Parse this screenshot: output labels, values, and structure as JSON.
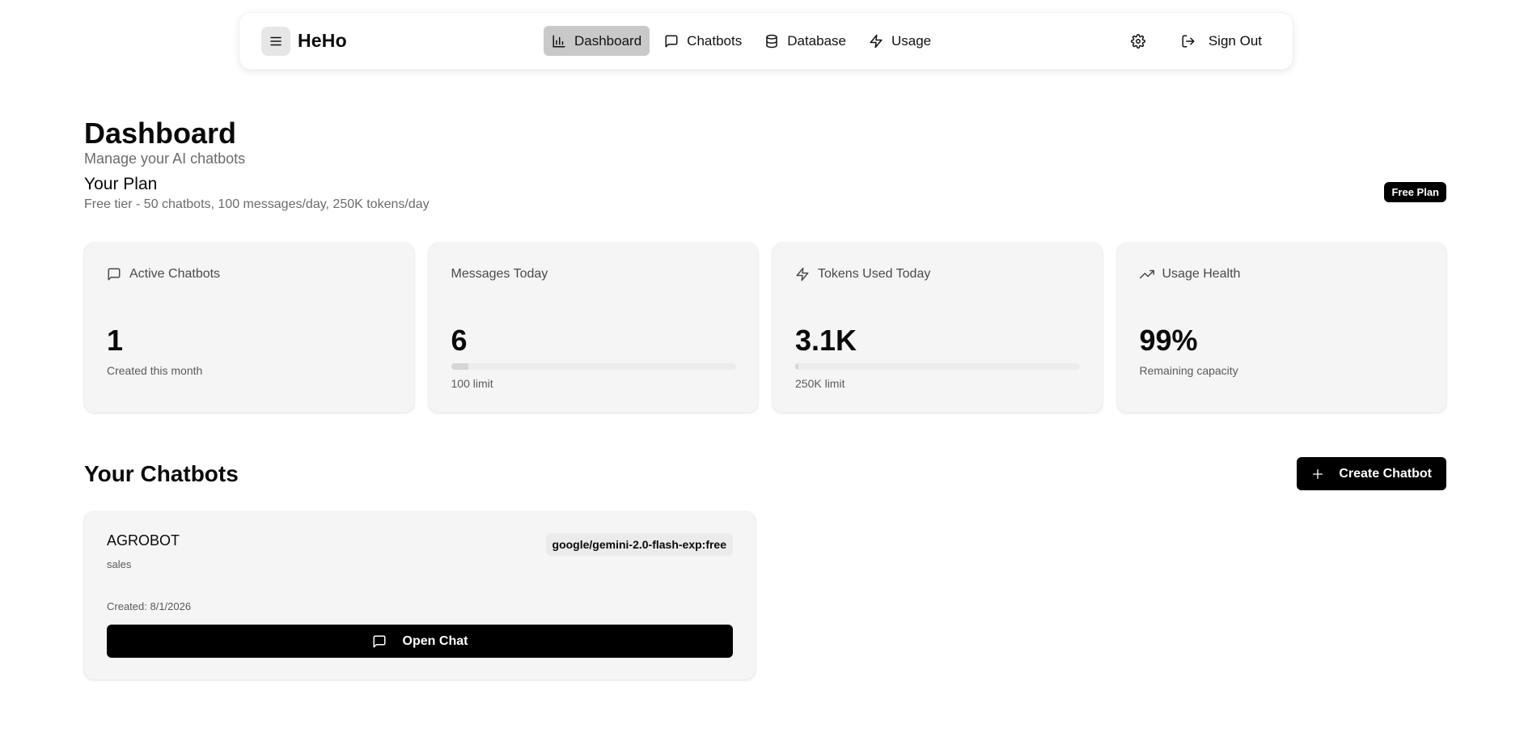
{
  "nav": {
    "brand": "HeHo",
    "items": [
      {
        "label": "Dashboard",
        "icon": "bar-chart-icon",
        "active": true
      },
      {
        "label": "Chatbots",
        "icon": "message-square-icon",
        "active": false
      },
      {
        "label": "Database",
        "icon": "database-icon",
        "active": false
      },
      {
        "label": "Usage",
        "icon": "zap-icon",
        "active": false
      }
    ],
    "sign_out_label": "Sign Out"
  },
  "header": {
    "title": "Dashboard",
    "subtitle": "Manage your AI chatbots",
    "plan_title": "Your Plan",
    "plan_desc": "Free tier - 50 chatbots, 100 messages/day, 250K tokens/day",
    "plan_badge": "Free Plan"
  },
  "stats": [
    {
      "title": "Active Chatbots",
      "icon": "message-square-icon",
      "value": "1",
      "sub": "Created this month"
    },
    {
      "title": "Messages Today",
      "icon": "",
      "value": "6",
      "sub": "100 limit",
      "progress": 0.06
    },
    {
      "title": "Tokens Used Today",
      "icon": "zap-icon",
      "value": "3.1K",
      "sub": "250K limit",
      "progress": 0.0124
    },
    {
      "title": "Usage Health",
      "icon": "trending-up-icon",
      "value": "99%",
      "sub": "Remaining capacity"
    }
  ],
  "chatbots_section": {
    "title": "Your Chatbots",
    "create_label": "Create Chatbot"
  },
  "chatbots": [
    {
      "name": "AGROBOT",
      "category": "sales",
      "model": "google/gemini-2.0-flash-exp:free",
      "created": "Created: 8/1/2026",
      "open_label": "Open Chat"
    }
  ]
}
